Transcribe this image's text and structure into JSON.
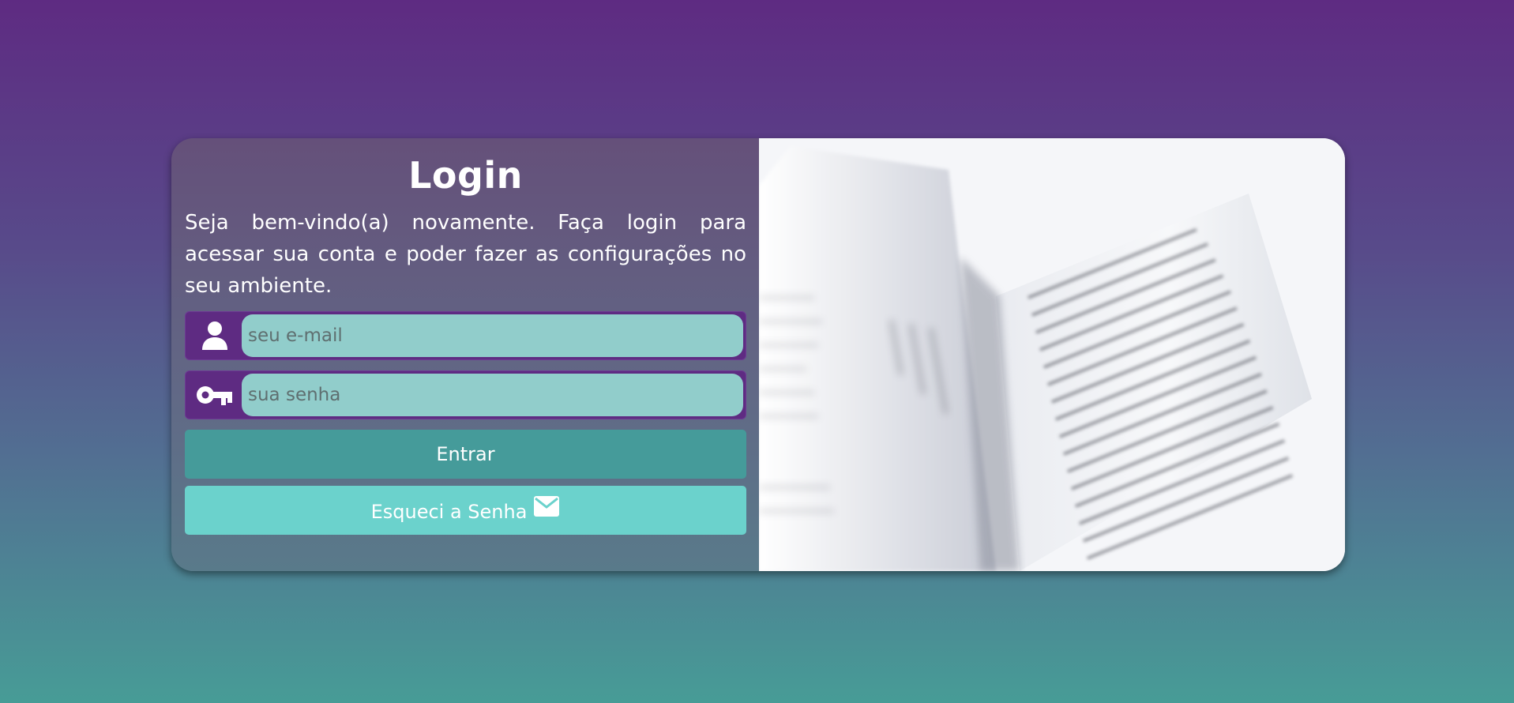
{
  "login": {
    "title": "Login",
    "intro": "Seja bem-vindo(a) novamente. Faça login para acessar sua conta e poder fazer as configurações no seu ambiente.",
    "email_placeholder": "seu e-mail",
    "password_placeholder": "sua senha",
    "submit_label": "Entrar",
    "forgot_label": "Esqueci a Senha"
  },
  "icons": {
    "user": "user-icon",
    "key": "key-icon",
    "mail": "mail-icon"
  },
  "colors": {
    "background_top": "#5e2b82",
    "background_bottom": "#479c96",
    "input_bg": "#91cdcb",
    "icon_bg": "#5e2b82",
    "submit_bg": "#459b9a",
    "forgot_bg": "#6bd2cc"
  }
}
